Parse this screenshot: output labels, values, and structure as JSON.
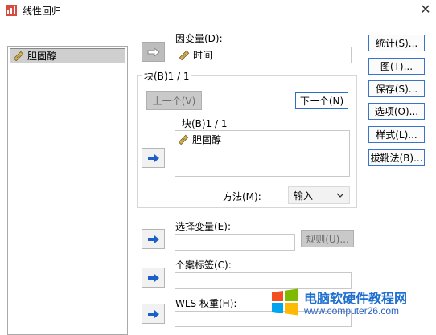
{
  "window": {
    "title": "线性回归",
    "close_glyph": "✕"
  },
  "source_list": {
    "items": [
      {
        "label": "胆固醇",
        "icon": "scale-ruler-icon"
      }
    ]
  },
  "dependent": {
    "label": "因变量(D):",
    "value": "时间",
    "icon": "scale-ruler-icon"
  },
  "block": {
    "group_title": "块(B)1 / 1",
    "prev_label": "上一个(V)",
    "next_label": "下一个(N)",
    "inner_title": "块(B)1 / 1",
    "independent_items": [
      {
        "label": "胆固醇",
        "icon": "scale-ruler-icon"
      }
    ],
    "method_label": "方法(M):",
    "method_value": "输入"
  },
  "selection": {
    "label": "选择变量(E):",
    "rule_label": "规则(U)..."
  },
  "case_label": {
    "label": "个案标签(C):"
  },
  "wls": {
    "label": "WLS 权重(H):"
  },
  "side_buttons": [
    "统计(S)...",
    "图(T)...",
    "保存(S)...",
    "选项(O)...",
    "样式(L)...",
    "拔靴法(B)..."
  ],
  "watermark": {
    "title": "电脑软硬件教程网",
    "url": "www.computer26.com"
  },
  "colors": {
    "arrow_blue": "#1b5fc8",
    "accent_border": "#3874c9",
    "ruler_yellow": "#d7b24a"
  }
}
